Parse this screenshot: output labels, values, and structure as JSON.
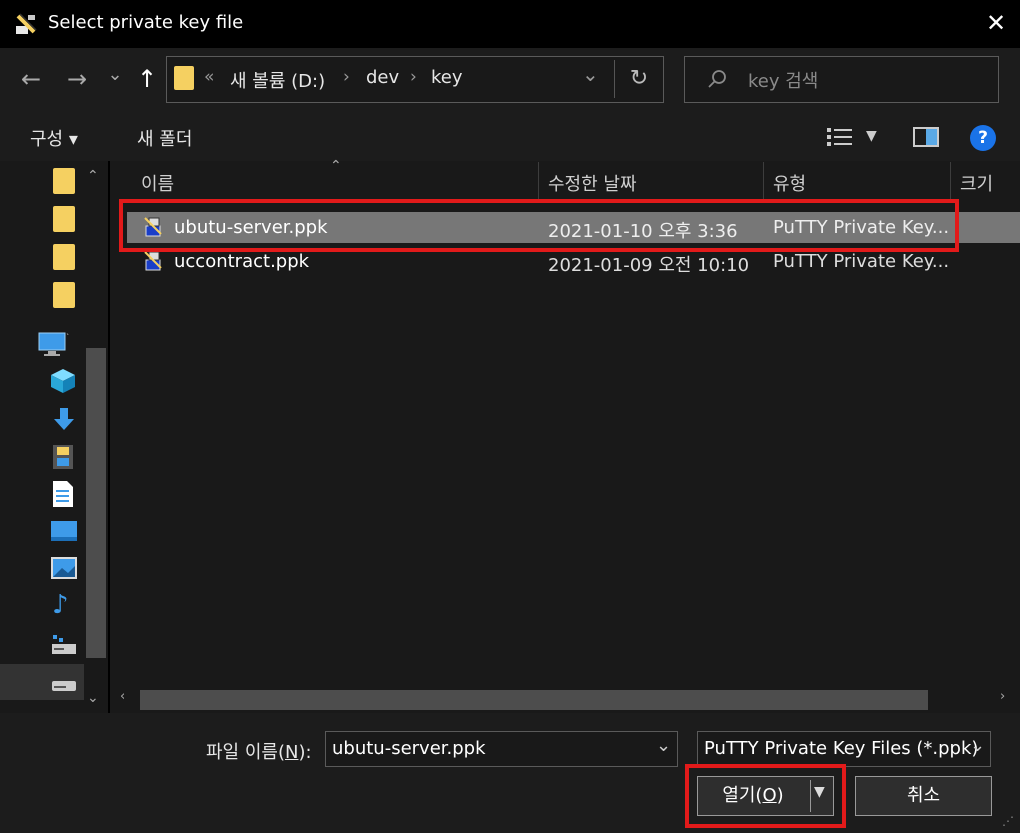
{
  "window": {
    "title": "Select private key file"
  },
  "nav": {
    "back": "←",
    "forward": "→",
    "recent": "⌄",
    "up": "↑",
    "refresh": "↻",
    "breadcrumb": [
      "«",
      "새 볼륨 (D:)",
      "dev",
      "key"
    ],
    "separator": "›",
    "dropdown": "⌄"
  },
  "search": {
    "placeholder": "key 검색"
  },
  "toolbar": {
    "organize": "구성 ▾",
    "new_folder": "새 폴더",
    "help": "?"
  },
  "columns": {
    "name": "이름",
    "modified": "수정한 날짜",
    "type": "유형",
    "size": "크기"
  },
  "files": [
    {
      "name": "ubutu-server.ppk",
      "modified": "2021-01-10 오후 3:36",
      "type": "PuTTY Private Key..."
    },
    {
      "name": "uccontract.ppk",
      "modified": "2021-01-09 오전 10:10",
      "type": "PuTTY Private Key..."
    }
  ],
  "footer": {
    "filename_label_pre": "파일 이름(",
    "filename_label_key": "N",
    "filename_label_post": "):",
    "filename_value": "ubutu-server.ppk",
    "filetype_value": "PuTTY Private Key Files (*.ppk)",
    "open_pre": "열기(",
    "open_key": "O",
    "open_post": ")",
    "cancel": "취소"
  },
  "colors": {
    "highlight": "#e21a1a",
    "selection": "#777777",
    "folder": "#f5d061",
    "help": "#1a73e8"
  }
}
